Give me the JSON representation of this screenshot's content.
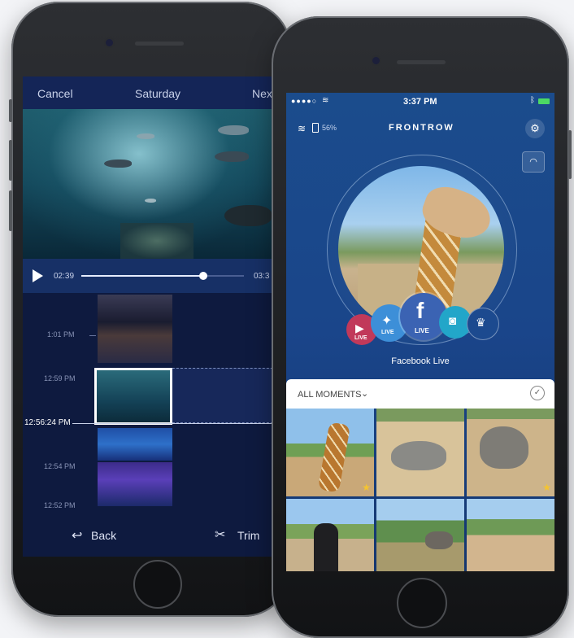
{
  "left_app": {
    "cancel_label": "Cancel",
    "title": "Saturday",
    "next_label": "Nex",
    "current_time": "02:39",
    "end_time": "03:3",
    "progress": 0.75,
    "timeline_labels": [
      "1:01 PM",
      "12:59 PM",
      "12:54 PM",
      "12:52 PM"
    ],
    "scrubber_time": "12:56:24 PM",
    "back_label": "Back",
    "trim_label": "Trim"
  },
  "right_app": {
    "status": {
      "signal": "●●●●○",
      "time": "3:37 PM"
    },
    "header": {
      "battery": "56%",
      "title": "FRONTROW"
    },
    "share_buttons": [
      {
        "name": "youtube",
        "tag": "LIVE",
        "color": "#c1395a"
      },
      {
        "name": "twitter",
        "tag": "LIVE",
        "color": "#3d8fd8"
      },
      {
        "name": "facebook",
        "tag": "LIVE",
        "color": "#3b63b3"
      },
      {
        "name": "camera",
        "tag": "",
        "color": "#22a6c9"
      },
      {
        "name": "crown",
        "tag": "",
        "color": "#1c4a8f"
      }
    ],
    "selected_service": "Facebook Live",
    "moments_label": "ALL MOMENTS",
    "colors": {
      "accent": "#1b4c8c",
      "star": "#f4c430"
    }
  }
}
